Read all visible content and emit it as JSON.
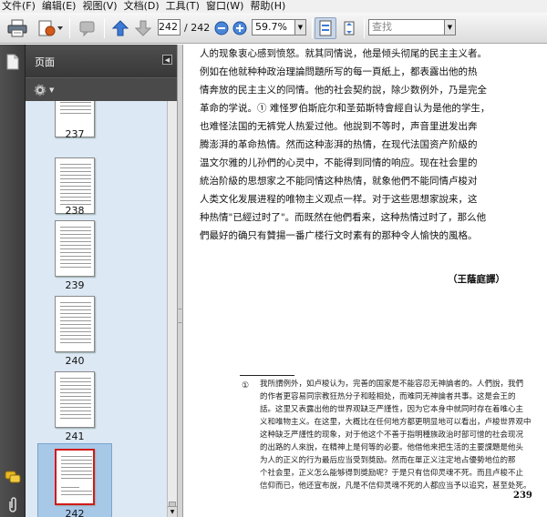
{
  "menu": [
    {
      "label": "文件(F)"
    },
    {
      "label": "编辑(E)"
    },
    {
      "label": "视图(V)"
    },
    {
      "label": "文档(D)"
    },
    {
      "label": "工具(T)"
    },
    {
      "label": "窗口(W)"
    },
    {
      "label": "帮助(H)"
    }
  ],
  "toolbar": {
    "page_current": "242",
    "page_total": "/ 242",
    "zoom": "59.7%",
    "search_placeholder": "查找"
  },
  "sidebar": {
    "title": "页面",
    "thumbnails": [
      {
        "label": "237"
      },
      {
        "label": "238"
      },
      {
        "label": "239"
      },
      {
        "label": "240"
      },
      {
        "label": "241"
      },
      {
        "label": "242"
      }
    ],
    "selected_index": 5
  },
  "document": {
    "paragraph_lines": [
      "人的现象衷心感到愤怒。就其同情说，他是倾头彻尾的民主主义者。",
      "例如在他就种种政治理論問題所写的每一頁紙上，都表露出他的热",
      "情奔放的民主主义的同情。他的社会契約說，除少数例外，乃是完全",
      "革命的学说。① 难怪罗伯斯庇尔和圣茹斯特會經自认为是他的学生，",
      "也难怪法国的无裤党人热爱过他。他說到不等时，声音里迸发出奔",
      "腾澎湃的革命热情。然而这种澎湃的热情，在现代法国资产阶級的",
      "温文尔雅的儿孙們的心灵中，不能得到同情的响应。现在社会里的",
      "統治阶級的思想家之不能同情这种热情，就象他們不能同情卢梭对",
      "人类文化发展进程的唯物主义观点一样。对于这些思想家說来，这",
      "种热情\"已經过时了\"。而既然在他們看来，这种热情过时了，那么他",
      "們最好的确只有贊揚一番广楼行文时素有的那种令人愉快的風格。"
    ],
    "signature": "（王蔭庭譯）",
    "footnote_mark": "①",
    "footnote_lines": [
      "我所謂例外，如卢梭认为，完善的国家是不能容忍无神論者的。人們說，我們",
      "的作者更容易同宗教狂热分子和睦相处，而难同无神論者共事。这是会王的",
      "話。这里又表露出他的世界观缺乏严謹性，因为它本身中就同时存在着唯心主",
      "义和唯物主义。在这里，大概比在任何地方都更明显地可以看出，卢梭世界观中",
      "这种缺乏严謹性的现象，对于他这个不善于指明種族政治时部可憎的社会现况",
      "的出路的人來說，在精神上是何等的必要。他借他来把生活的主要課題是他头",
      "为人的正义的行为最后应当受到獎励。然而在單正义注定地占優勢地位的那",
      "个社会里，正义怎么能够得到獎励呢？于是只有信仰灵魂不死。而且卢梭不止",
      "信仰而已，他还宣布說，凡是不信仰灵魂不死的人都应当予以追究，甚至处死。"
    ],
    "page_number": "239"
  }
}
